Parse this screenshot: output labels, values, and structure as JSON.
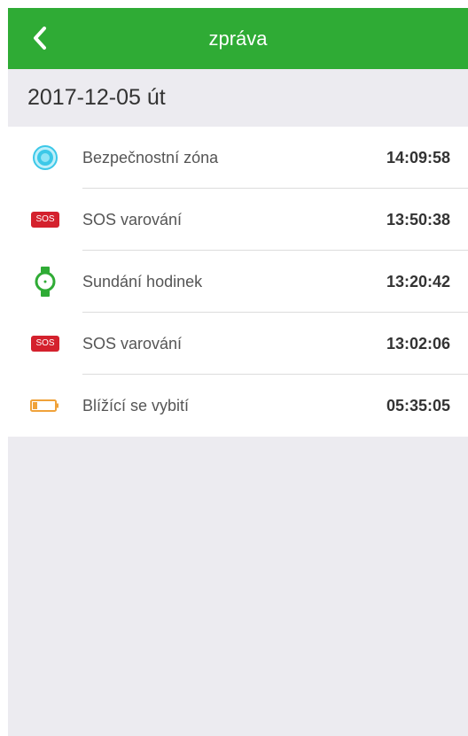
{
  "header": {
    "title": "zpráva"
  },
  "date_header": "2017-12-05 út",
  "items": [
    {
      "icon": "safe-zone-icon",
      "label": "Bezpečnostní zóna",
      "time": "14:09:58"
    },
    {
      "icon": "sos-icon",
      "badge": "SOS",
      "label": "SOS varování",
      "time": "13:50:38"
    },
    {
      "icon": "watch-icon",
      "label": "Sundání hodinek",
      "time": "13:20:42"
    },
    {
      "icon": "sos-icon",
      "badge": "SOS",
      "label": "SOS varování",
      "time": "13:02:06"
    },
    {
      "icon": "low-battery-icon",
      "label": "Blížící se vybití",
      "time": "05:35:05"
    }
  ],
  "colors": {
    "header_bg": "#2fab35",
    "sos_red": "#d4212d",
    "watch_green": "#2fab35",
    "zone_cyan": "#3cc8e8",
    "battery_orange": "#f0a23a"
  }
}
